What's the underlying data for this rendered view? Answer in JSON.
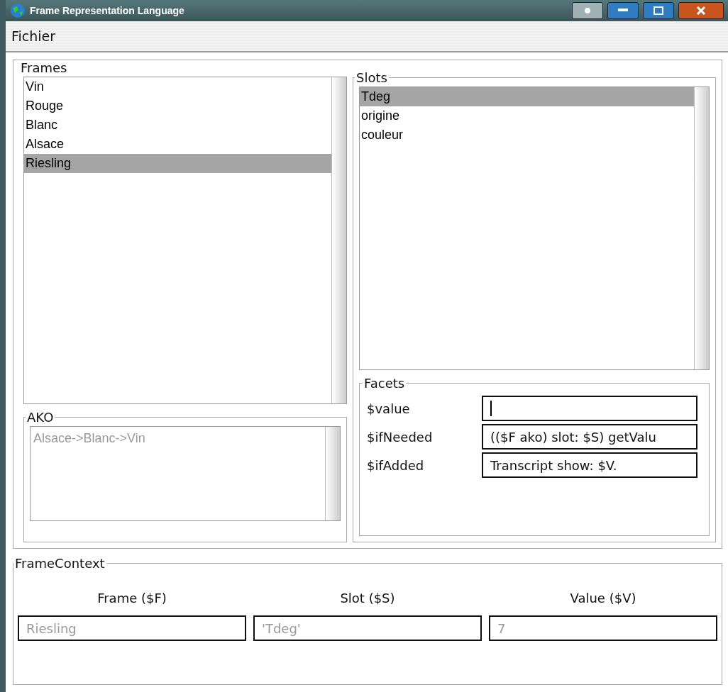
{
  "window": {
    "title": "Frame Representation Language"
  },
  "menu": [
    "Fichier"
  ],
  "frames": {
    "title": "Frames",
    "items": [
      {
        "label": "Vin",
        "selected": false
      },
      {
        "label": "Rouge",
        "selected": false
      },
      {
        "label": "Blanc",
        "selected": false
      },
      {
        "label": "Alsace",
        "selected": false
      },
      {
        "label": "Riesling",
        "selected": true
      }
    ]
  },
  "ako": {
    "title": "AKO",
    "items": [
      "Alsace->Blanc->Vin"
    ]
  },
  "slots": {
    "title": "Slots",
    "items": [
      {
        "label": "Tdeg",
        "selected": true
      },
      {
        "label": "origine",
        "selected": false
      },
      {
        "label": "couleur",
        "selected": false
      }
    ]
  },
  "facets": {
    "title": "Facets",
    "rows": [
      {
        "label": "$value",
        "focused": true
      },
      {
        "label": "$ifNeeded",
        "value": "(($F ako) slot: $S) getValu",
        "focused": false
      },
      {
        "label": "$ifAdded",
        "value": "Transcript show: $V.",
        "focused": false
      }
    ]
  },
  "context": {
    "title": "FrameContext",
    "columns": [
      {
        "label": "Frame ($F)",
        "value": "Riesling",
        "disabled": true
      },
      {
        "label": "Slot ($S)",
        "value": "'Tdeg'",
        "disabled": true
      },
      {
        "label": "Value ($V)",
        "value": "7",
        "disabled": true
      }
    ]
  }
}
